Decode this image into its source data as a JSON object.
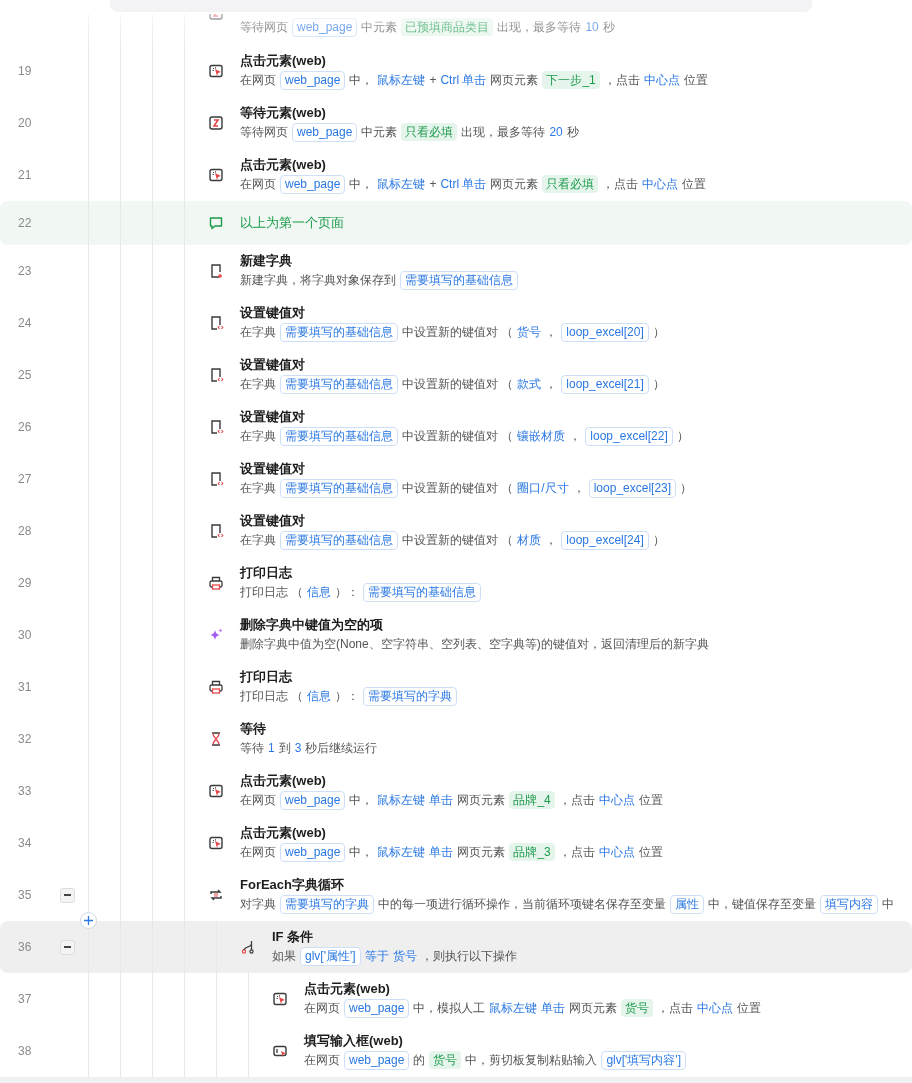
{
  "steps": [
    {
      "kind": "wait_element",
      "selected": false,
      "desc": [
        {
          "kind": "text",
          "text": "等待网页"
        },
        {
          "kind": "var",
          "text": "web_page"
        },
        {
          "kind": "text",
          "text": "中元素"
        },
        {
          "kind": "elem",
          "text": "已预填商品类目"
        },
        {
          "kind": "text",
          "text": "出现，最多等待"
        },
        {
          "kind": "kw",
          "text": "10"
        },
        {
          "kind": "text",
          "text": "秒"
        }
      ]
    },
    {
      "line": "19",
      "kind": "click",
      "selected": false,
      "title": "点击元素(web)",
      "desc": [
        {
          "kind": "text",
          "text": "在网页"
        },
        {
          "kind": "var",
          "text": "web_page"
        },
        {
          "kind": "text",
          "text": "中，"
        },
        {
          "kind": "kw",
          "text": "鼠标左键"
        },
        {
          "kind": "text",
          "text": "+"
        },
        {
          "kind": "kw",
          "text": "Ctrl 单击"
        },
        {
          "kind": "text",
          "text": "网页元素"
        },
        {
          "kind": "elem",
          "text": "下一步_1"
        },
        {
          "kind": "text",
          "text": "，点击"
        },
        {
          "kind": "kw",
          "text": "中心点"
        },
        {
          "kind": "text",
          "text": "位置"
        }
      ]
    },
    {
      "line": "20",
      "kind": "wait_element",
      "selected": false,
      "title": "等待元素(web)",
      "desc": [
        {
          "kind": "text",
          "text": "等待网页"
        },
        {
          "kind": "var",
          "text": "web_page"
        },
        {
          "kind": "text",
          "text": "中元素"
        },
        {
          "kind": "elem",
          "text": "只看必填"
        },
        {
          "kind": "text",
          "text": "出现，最多等待"
        },
        {
          "kind": "kw",
          "text": "20"
        },
        {
          "kind": "text",
          "text": "秒"
        }
      ]
    },
    {
      "line": "21",
      "kind": "click",
      "selected": false,
      "title": "点击元素(web)",
      "desc": [
        {
          "kind": "text",
          "text": "在网页"
        },
        {
          "kind": "var",
          "text": "web_page"
        },
        {
          "kind": "text",
          "text": "中，"
        },
        {
          "kind": "kw",
          "text": "鼠标左键"
        },
        {
          "kind": "text",
          "text": "+"
        },
        {
          "kind": "kw",
          "text": "Ctrl 单击"
        },
        {
          "kind": "text",
          "text": "网页元素"
        },
        {
          "kind": "elem",
          "text": "只看必填"
        },
        {
          "kind": "text",
          "text": "，点击"
        },
        {
          "kind": "kw",
          "text": "中心点"
        },
        {
          "kind": "text",
          "text": "位置"
        }
      ]
    },
    {
      "line": "22",
      "kind": "comment",
      "selected": false,
      "title": "以上为第一个页面"
    },
    {
      "line": "23",
      "kind": "new_dict",
      "selected": false,
      "title": "新建字典",
      "desc": [
        {
          "kind": "text",
          "text": "新建字典，将字典对象保存到"
        },
        {
          "kind": "var",
          "text": "需要填写的基础信息"
        }
      ]
    },
    {
      "line": "24",
      "kind": "set_kv",
      "selected": false,
      "title": "设置键值对",
      "desc": [
        {
          "kind": "text",
          "text": "在字典"
        },
        {
          "kind": "var",
          "text": "需要填写的基础信息"
        },
        {
          "kind": "text",
          "text": "中设置新的键值对 （"
        },
        {
          "kind": "kw",
          "text": "货号"
        },
        {
          "kind": "text",
          "text": "，"
        },
        {
          "kind": "var",
          "text": "loop_excel[20]"
        },
        {
          "kind": "text",
          "text": "）"
        }
      ]
    },
    {
      "line": "25",
      "kind": "set_kv",
      "selected": false,
      "title": "设置键值对",
      "desc": [
        {
          "kind": "text",
          "text": "在字典"
        },
        {
          "kind": "var",
          "text": "需要填写的基础信息"
        },
        {
          "kind": "text",
          "text": "中设置新的键值对 （"
        },
        {
          "kind": "kw",
          "text": "款式"
        },
        {
          "kind": "text",
          "text": "，"
        },
        {
          "kind": "var",
          "text": "loop_excel[21]"
        },
        {
          "kind": "text",
          "text": "）"
        }
      ]
    },
    {
      "line": "26",
      "kind": "set_kv",
      "selected": false,
      "title": "设置键值对",
      "desc": [
        {
          "kind": "text",
          "text": "在字典"
        },
        {
          "kind": "var",
          "text": "需要填写的基础信息"
        },
        {
          "kind": "text",
          "text": "中设置新的键值对 （"
        },
        {
          "kind": "kw",
          "text": "镶嵌材质"
        },
        {
          "kind": "text",
          "text": "，"
        },
        {
          "kind": "var",
          "text": "loop_excel[22]"
        },
        {
          "kind": "text",
          "text": "）"
        }
      ]
    },
    {
      "line": "27",
      "kind": "set_kv",
      "selected": false,
      "title": "设置键值对",
      "desc": [
        {
          "kind": "text",
          "text": "在字典"
        },
        {
          "kind": "var",
          "text": "需要填写的基础信息"
        },
        {
          "kind": "text",
          "text": "中设置新的键值对 （"
        },
        {
          "kind": "kw",
          "text": "圈口/尺寸"
        },
        {
          "kind": "text",
          "text": "，"
        },
        {
          "kind": "var",
          "text": "loop_excel[23]"
        },
        {
          "kind": "text",
          "text": "）"
        }
      ]
    },
    {
      "line": "28",
      "kind": "set_kv",
      "selected": false,
      "title": "设置键值对",
      "desc": [
        {
          "kind": "text",
          "text": "在字典"
        },
        {
          "kind": "var",
          "text": "需要填写的基础信息"
        },
        {
          "kind": "text",
          "text": "中设置新的键值对 （"
        },
        {
          "kind": "kw",
          "text": "材质"
        },
        {
          "kind": "text",
          "text": "，"
        },
        {
          "kind": "var",
          "text": "loop_excel[24]"
        },
        {
          "kind": "text",
          "text": "）"
        }
      ]
    },
    {
      "line": "29",
      "kind": "print",
      "selected": false,
      "title": "打印日志",
      "desc": [
        {
          "kind": "text",
          "text": "打印日志 （"
        },
        {
          "kind": "kw",
          "text": "信息"
        },
        {
          "kind": "text",
          "text": "）："
        },
        {
          "kind": "var",
          "text": "需要填写的基础信息"
        }
      ]
    },
    {
      "line": "30",
      "kind": "sparkle",
      "selected": false,
      "title": "删除字典中键值为空的项",
      "desc": [
        {
          "kind": "text",
          "text": "删除字典中值为空(None、空字符串、空列表、空字典等)的键值对，返回清理后的新字典"
        }
      ]
    },
    {
      "line": "31",
      "kind": "print",
      "selected": false,
      "title": "打印日志",
      "desc": [
        {
          "kind": "text",
          "text": "打印日志 （"
        },
        {
          "kind": "kw",
          "text": "信息"
        },
        {
          "kind": "text",
          "text": "）："
        },
        {
          "kind": "var",
          "text": "需要填写的字典"
        }
      ]
    },
    {
      "line": "32",
      "kind": "hourglass",
      "selected": false,
      "title": "等待",
      "desc": [
        {
          "kind": "text",
          "text": "等待"
        },
        {
          "kind": "kw",
          "text": "1"
        },
        {
          "kind": "text",
          "text": "到"
        },
        {
          "kind": "kw",
          "text": "3"
        },
        {
          "kind": "text",
          "text": "秒后继续运行"
        }
      ]
    },
    {
      "line": "33",
      "kind": "click",
      "selected": false,
      "title": "点击元素(web)",
      "desc": [
        {
          "kind": "text",
          "text": "在网页"
        },
        {
          "kind": "var",
          "text": "web_page"
        },
        {
          "kind": "text",
          "text": "中，"
        },
        {
          "kind": "kw",
          "text": "鼠标左键"
        },
        {
          "kind": "kw",
          "text": "单击"
        },
        {
          "kind": "text",
          "text": "网页元素"
        },
        {
          "kind": "elem",
          "text": "品牌_4"
        },
        {
          "kind": "text",
          "text": "，点击"
        },
        {
          "kind": "kw",
          "text": "中心点"
        },
        {
          "kind": "text",
          "text": "位置"
        }
      ]
    },
    {
      "line": "34",
      "kind": "click",
      "selected": false,
      "title": "点击元素(web)",
      "desc": [
        {
          "kind": "text",
          "text": "在网页"
        },
        {
          "kind": "var",
          "text": "web_page"
        },
        {
          "kind": "text",
          "text": "中，"
        },
        {
          "kind": "kw",
          "text": "鼠标左键"
        },
        {
          "kind": "kw",
          "text": "单击"
        },
        {
          "kind": "text",
          "text": "网页元素"
        },
        {
          "kind": "elem",
          "text": "品牌_3"
        },
        {
          "kind": "text",
          "text": "，点击"
        },
        {
          "kind": "kw",
          "text": "中心点"
        },
        {
          "kind": "text",
          "text": "位置"
        }
      ]
    },
    {
      "line": "35",
      "kind": "loop",
      "selected": false,
      "expanded": true,
      "title": "ForEach字典循环",
      "desc": [
        {
          "kind": "text",
          "text": "对字典"
        },
        {
          "kind": "var",
          "text": "需要填写的字典"
        },
        {
          "kind": "text",
          "text": "中的每一项进行循环操作，当前循环项键名保存至变量"
        },
        {
          "kind": "var",
          "text": "属性"
        },
        {
          "kind": "text",
          "text": "中，键值保存至变量"
        },
        {
          "kind": "var",
          "text": "填写内容"
        },
        {
          "kind": "text",
          "text": "中"
        }
      ],
      "children": [
        {
          "line": "36",
          "kind": "branch",
          "selected": true,
          "expanded": true,
          "title": "IF 条件",
          "desc": [
            {
              "kind": "text",
              "text": "如果"
            },
            {
              "kind": "var",
              "text": "glv['属性']"
            },
            {
              "kind": "kw",
              "text": "等于"
            },
            {
              "kind": "kw",
              "text": "货号"
            },
            {
              "kind": "text",
              "text": "，则执行以下操作"
            }
          ],
          "children": [
            {
              "line": "37",
              "kind": "click",
              "selected": false,
              "title": "点击元素(web)",
              "desc": [
                {
                  "kind": "text",
                  "text": "在网页"
                },
                {
                  "kind": "var",
                  "text": "web_page"
                },
                {
                  "kind": "text",
                  "text": "中，模拟人工"
                },
                {
                  "kind": "kw",
                  "text": "鼠标左键"
                },
                {
                  "kind": "kw",
                  "text": "单击"
                },
                {
                  "kind": "text",
                  "text": "网页元素"
                },
                {
                  "kind": "elem",
                  "text": "货号"
                },
                {
                  "kind": "text",
                  "text": "，点击"
                },
                {
                  "kind": "kw",
                  "text": "中心点"
                },
                {
                  "kind": "text",
                  "text": "位置"
                }
              ]
            },
            {
              "line": "38",
              "kind": "input",
              "selected": false,
              "title": "填写输入框(web)",
              "desc": [
                {
                  "kind": "text",
                  "text": "在网页"
                },
                {
                  "kind": "var",
                  "text": "web_page"
                },
                {
                  "kind": "text",
                  "text": "的"
                },
                {
                  "kind": "elem",
                  "text": "货号"
                },
                {
                  "kind": "text",
                  "text": "中，剪切板复制粘贴输入"
                },
                {
                  "kind": "var",
                  "text": "glv['填写内容']"
                }
              ]
            }
          ]
        }
      ]
    }
  ]
}
